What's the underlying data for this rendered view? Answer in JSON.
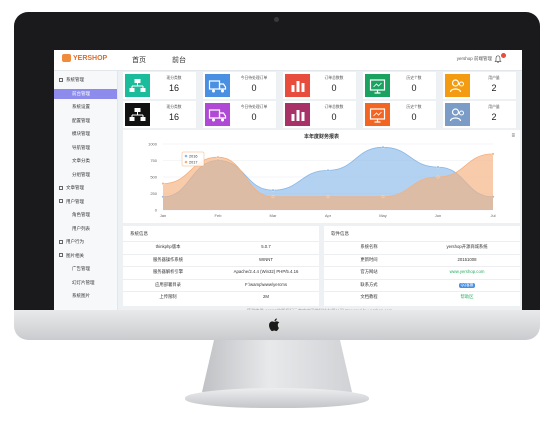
{
  "header": {
    "logo_text": "YERSHOP",
    "nav": [
      "首页",
      "前台"
    ],
    "user": "yershop 前端管理"
  },
  "sidebar": {
    "items": [
      {
        "label": "系统管理",
        "type": "group"
      },
      {
        "label": "前台管理",
        "type": "active"
      },
      {
        "label": "系统设置",
        "type": "sub"
      },
      {
        "label": "配置管理",
        "type": "sub"
      },
      {
        "label": "模块管理",
        "type": "sub"
      },
      {
        "label": "导航管理",
        "type": "sub"
      },
      {
        "label": "文章分类",
        "type": "sub"
      },
      {
        "label": "分组管理",
        "type": "sub"
      },
      {
        "label": "文章管理",
        "type": "group"
      },
      {
        "label": "用户管理",
        "type": "group"
      },
      {
        "label": "角色管理",
        "type": "sub"
      },
      {
        "label": "用户列表",
        "type": "sub"
      },
      {
        "label": "用户行为",
        "type": "group"
      },
      {
        "label": "图片相关",
        "type": "group"
      },
      {
        "label": "广告管理",
        "type": "sub"
      },
      {
        "label": "幻灯片管理",
        "type": "sub"
      },
      {
        "label": "系统图片",
        "type": "sub"
      }
    ]
  },
  "stats_row1": [
    {
      "label": "现分类数",
      "value": "16",
      "color": "#1abc9c",
      "icon": "sitemap-icon"
    },
    {
      "label": "今日待处理订单",
      "value": "0",
      "color": "#4a90e2",
      "icon": "truck-icon"
    },
    {
      "label": "订单总数数",
      "value": "0",
      "color": "#e74c3c",
      "icon": "bar-chart-icon"
    },
    {
      "label": "历史个数",
      "value": "0",
      "color": "#1aa260",
      "icon": "monitor-icon"
    },
    {
      "label": "用户量",
      "value": "2",
      "color": "#f39c12",
      "icon": "users-icon"
    }
  ],
  "stats_row2": [
    {
      "label": "现分类数",
      "value": "16",
      "color": "#111111",
      "icon": "sitemap-icon"
    },
    {
      "label": "今日待处理订单",
      "value": "0",
      "color": "#b04ad6",
      "icon": "truck-icon"
    },
    {
      "label": "订单总数数",
      "value": "0",
      "color": "#a83268",
      "icon": "bar-chart-icon"
    },
    {
      "label": "历史个数",
      "value": "0",
      "color": "#f26522",
      "icon": "monitor-icon"
    },
    {
      "label": "用户量",
      "value": "2",
      "color": "#7a9cc6",
      "icon": "users-icon"
    }
  ],
  "chart_data": {
    "type": "area",
    "title": "本年度财务报表",
    "categories": [
      "Jan",
      "Feb",
      "Mar",
      "Apr",
      "May",
      "Jun",
      "Jul"
    ],
    "ylim": [
      0,
      1000
    ],
    "yticks": [
      0,
      250,
      500,
      750,
      1000
    ],
    "ylabel": "",
    "legend_position": "top-left",
    "series": [
      {
        "name": "2016",
        "color": "#8ab8e8",
        "values": [
          200,
          750,
          300,
          600,
          950,
          650,
          200
        ]
      },
      {
        "name": "2017",
        "color": "#f4b07e",
        "values": [
          400,
          800,
          200,
          200,
          200,
          500,
          850
        ]
      }
    ]
  },
  "system_info": {
    "title": "系统信息",
    "rows": [
      {
        "k": "thinkphp版本",
        "v": "5.0.7"
      },
      {
        "k": "服务器操作系统",
        "v": "WINNT"
      },
      {
        "k": "服务器解析引擎",
        "v": "Apache/2.4.4 (Win32) PHP/5.4.16"
      },
      {
        "k": "应用部署目录",
        "v": "F:\\wamp\\www\\yercms"
      },
      {
        "k": "上传限制",
        "v": "2M"
      }
    ]
  },
  "software_info": {
    "title": "软件信息",
    "rows": [
      {
        "k": "系统名称",
        "v": "yershop开源商城系统"
      },
      {
        "k": "更新时间",
        "v": "20151008"
      },
      {
        "k": "官方网站",
        "v": "www.yershop.com"
      },
      {
        "k": "联系方式",
        "v": "QQ客服"
      },
      {
        "k": "文档教程",
        "v": "帮助区"
      }
    ]
  },
  "footer": "感谢使用yercms的版权归云南哆哆网络科技有限公司 Powered by yershop.com"
}
